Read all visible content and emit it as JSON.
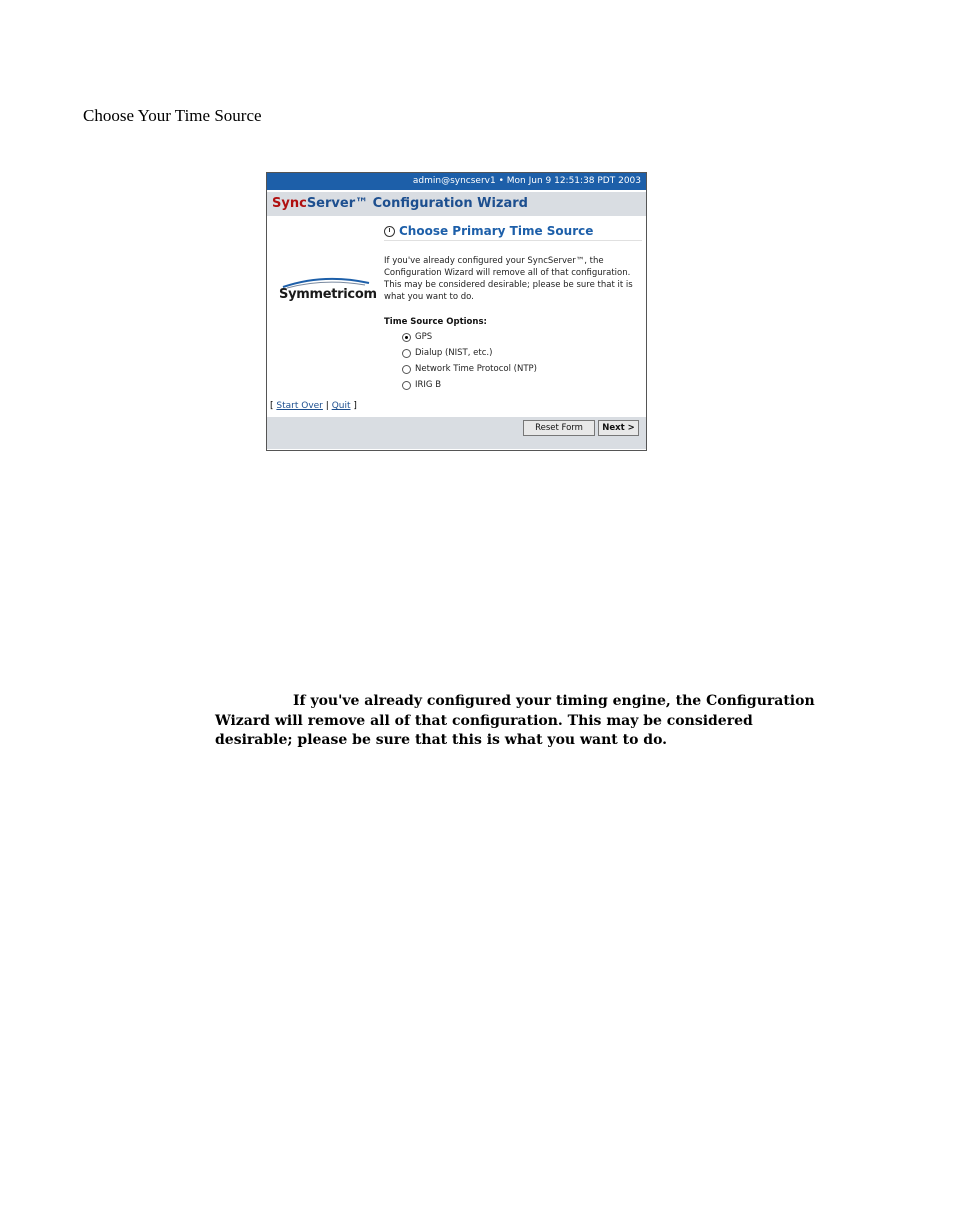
{
  "section_title": "Choose Your Time Source",
  "wizard": {
    "status_bar": "admin@syncserv1 • Mon Jun 9 12:51:38 PDT 2003",
    "app_title_sync": "Sync",
    "app_title_rest": "Server™ Configuration Wizard",
    "logo_text": "Symmetricom",
    "page_title": "Choose Primary Time Source",
    "description": "If you've already configured your SyncServer™, the Configuration Wizard will remove all of that configuration. This may be considered desirable; please be sure that it is what you want to do.",
    "options_label": "Time Source Options:",
    "options": [
      {
        "label": "GPS",
        "selected": true
      },
      {
        "label": "Dialup (NIST, etc.)",
        "selected": false
      },
      {
        "label": "Network Time Protocol (NTP)",
        "selected": false
      },
      {
        "label": "IRIG B",
        "selected": false
      }
    ],
    "links": {
      "open": "[",
      "start_over": "Start Over",
      "sep": "|",
      "quit": "Quit",
      "close": "]"
    },
    "buttons": {
      "reset": "Reset Form",
      "next": "Next >"
    }
  },
  "note": "If you've already configured your timing engine, the Configuration Wizard will remove all of that configuration. This may be considered desirable; please be sure that this is what you want to do."
}
